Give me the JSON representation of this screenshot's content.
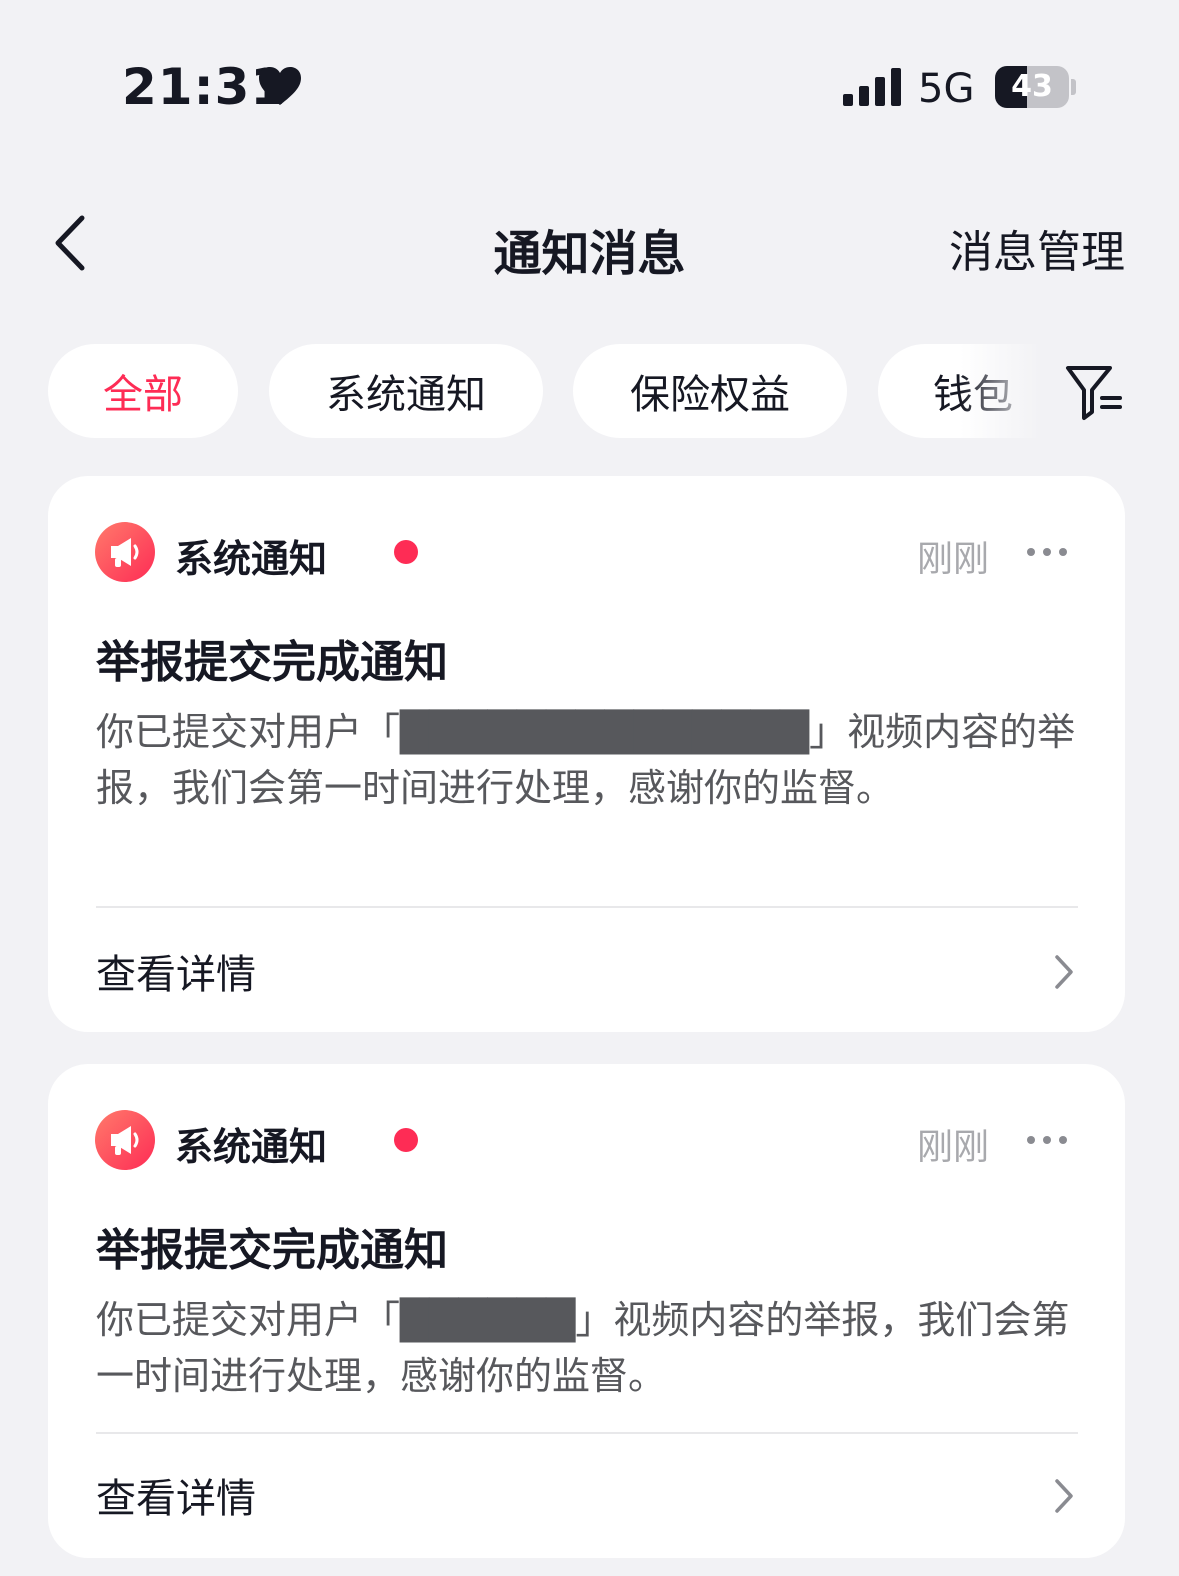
{
  "status_bar": {
    "time": "21:31",
    "network": "5G",
    "battery": "43",
    "battery_level": 43
  },
  "nav": {
    "title": "通知消息",
    "manage": "消息管理"
  },
  "tabs": [
    {
      "label": "全部",
      "active": true
    },
    {
      "label": "系统通知",
      "active": false
    },
    {
      "label": "保险权益",
      "active": false
    },
    {
      "label": "钱包",
      "active": false
    }
  ],
  "notifications": [
    {
      "source": "系统通知",
      "time": "刚刚",
      "title": "举报提交完成通知",
      "body": "你已提交对用户「██████████████」视频内容的举报，我们会第一时间进行处理，感谢你的监督。",
      "action": "查看详情"
    },
    {
      "source": "系统通知",
      "time": "刚刚",
      "title": "举报提交完成通知",
      "body": "你已提交对用户「██████」视频内容的举报，我们会第一时间进行处理，感谢你的监督。",
      "action": "查看详情"
    }
  ],
  "colors": {
    "accent": "#fe2c55",
    "background": "#f2f2f5",
    "card": "#ffffff",
    "muted": "#a8a9ad"
  },
  "icons": [
    "heart-icon",
    "signal-icon",
    "back-icon",
    "filter-icon",
    "megaphone-icon",
    "more-icon",
    "chevron-right-icon"
  ]
}
